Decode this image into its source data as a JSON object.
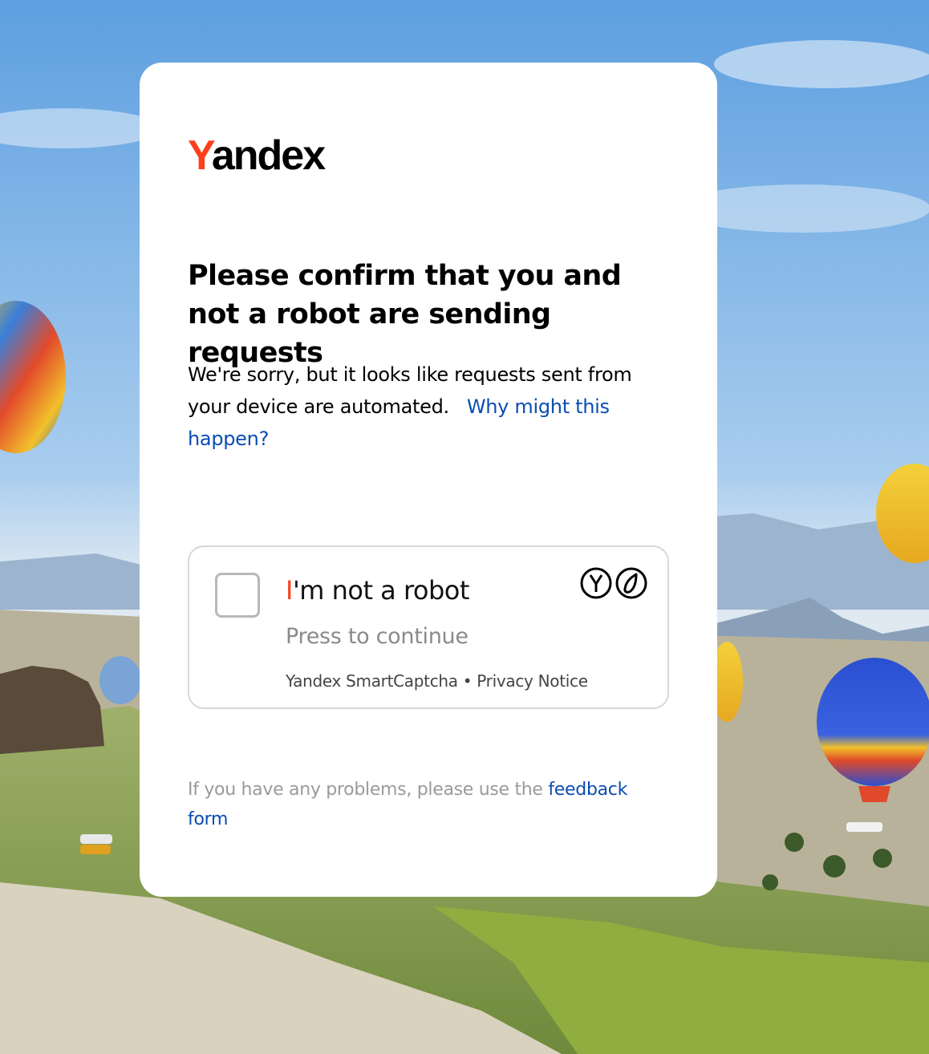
{
  "brand": {
    "logo_first_letter": "Y",
    "logo_rest": "andex",
    "logo_accent_color": "#fc3f1d"
  },
  "page": {
    "title": "Please confirm that you and not a robot are sending requests",
    "description": "We're sorry, but it looks like requests sent from your device are automated.",
    "why_link": "Why might this happen?",
    "link_color": "#0a4db3"
  },
  "captcha": {
    "label_accent": "I",
    "label_rest": "'m not a robot",
    "subtitle": "Press to continue",
    "footer_brand": "Yandex SmartCaptcha",
    "footer_separator": "•",
    "footer_privacy": "Privacy Notice",
    "icons": [
      "yandex-y-icon",
      "smartcaptcha-icon"
    ]
  },
  "feedback": {
    "prefix": "If you have any problems, please use the",
    "link": "feedback form"
  }
}
